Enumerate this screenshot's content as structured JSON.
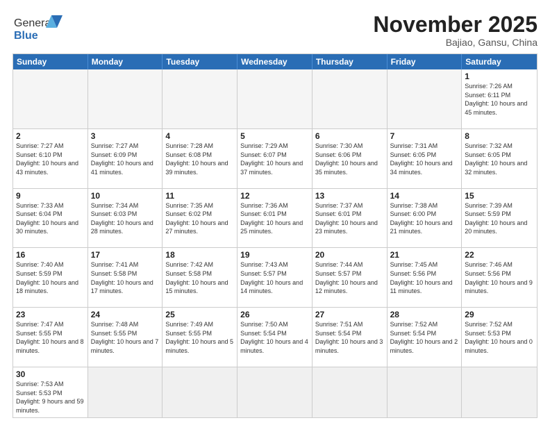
{
  "header": {
    "logo_general": "General",
    "logo_blue": "Blue",
    "title": "November 2025",
    "subtitle": "Bajiao, Gansu, China"
  },
  "days_of_week": [
    "Sunday",
    "Monday",
    "Tuesday",
    "Wednesday",
    "Thursday",
    "Friday",
    "Saturday"
  ],
  "weeks": [
    [
      {
        "day": "",
        "info": ""
      },
      {
        "day": "",
        "info": ""
      },
      {
        "day": "",
        "info": ""
      },
      {
        "day": "",
        "info": ""
      },
      {
        "day": "",
        "info": ""
      },
      {
        "day": "",
        "info": ""
      },
      {
        "day": "1",
        "info": "Sunrise: 7:26 AM\nSunset: 6:11 PM\nDaylight: 10 hours and 45 minutes."
      }
    ],
    [
      {
        "day": "2",
        "info": "Sunrise: 7:27 AM\nSunset: 6:10 PM\nDaylight: 10 hours and 43 minutes."
      },
      {
        "day": "3",
        "info": "Sunrise: 7:27 AM\nSunset: 6:09 PM\nDaylight: 10 hours and 41 minutes."
      },
      {
        "day": "4",
        "info": "Sunrise: 7:28 AM\nSunset: 6:08 PM\nDaylight: 10 hours and 39 minutes."
      },
      {
        "day": "5",
        "info": "Sunrise: 7:29 AM\nSunset: 6:07 PM\nDaylight: 10 hours and 37 minutes."
      },
      {
        "day": "6",
        "info": "Sunrise: 7:30 AM\nSunset: 6:06 PM\nDaylight: 10 hours and 35 minutes."
      },
      {
        "day": "7",
        "info": "Sunrise: 7:31 AM\nSunset: 6:05 PM\nDaylight: 10 hours and 34 minutes."
      },
      {
        "day": "8",
        "info": "Sunrise: 7:32 AM\nSunset: 6:05 PM\nDaylight: 10 hours and 32 minutes."
      }
    ],
    [
      {
        "day": "9",
        "info": "Sunrise: 7:33 AM\nSunset: 6:04 PM\nDaylight: 10 hours and 30 minutes."
      },
      {
        "day": "10",
        "info": "Sunrise: 7:34 AM\nSunset: 6:03 PM\nDaylight: 10 hours and 28 minutes."
      },
      {
        "day": "11",
        "info": "Sunrise: 7:35 AM\nSunset: 6:02 PM\nDaylight: 10 hours and 27 minutes."
      },
      {
        "day": "12",
        "info": "Sunrise: 7:36 AM\nSunset: 6:01 PM\nDaylight: 10 hours and 25 minutes."
      },
      {
        "day": "13",
        "info": "Sunrise: 7:37 AM\nSunset: 6:01 PM\nDaylight: 10 hours and 23 minutes."
      },
      {
        "day": "14",
        "info": "Sunrise: 7:38 AM\nSunset: 6:00 PM\nDaylight: 10 hours and 21 minutes."
      },
      {
        "day": "15",
        "info": "Sunrise: 7:39 AM\nSunset: 5:59 PM\nDaylight: 10 hours and 20 minutes."
      }
    ],
    [
      {
        "day": "16",
        "info": "Sunrise: 7:40 AM\nSunset: 5:59 PM\nDaylight: 10 hours and 18 minutes."
      },
      {
        "day": "17",
        "info": "Sunrise: 7:41 AM\nSunset: 5:58 PM\nDaylight: 10 hours and 17 minutes."
      },
      {
        "day": "18",
        "info": "Sunrise: 7:42 AM\nSunset: 5:58 PM\nDaylight: 10 hours and 15 minutes."
      },
      {
        "day": "19",
        "info": "Sunrise: 7:43 AM\nSunset: 5:57 PM\nDaylight: 10 hours and 14 minutes."
      },
      {
        "day": "20",
        "info": "Sunrise: 7:44 AM\nSunset: 5:57 PM\nDaylight: 10 hours and 12 minutes."
      },
      {
        "day": "21",
        "info": "Sunrise: 7:45 AM\nSunset: 5:56 PM\nDaylight: 10 hours and 11 minutes."
      },
      {
        "day": "22",
        "info": "Sunrise: 7:46 AM\nSunset: 5:56 PM\nDaylight: 10 hours and 9 minutes."
      }
    ],
    [
      {
        "day": "23",
        "info": "Sunrise: 7:47 AM\nSunset: 5:55 PM\nDaylight: 10 hours and 8 minutes."
      },
      {
        "day": "24",
        "info": "Sunrise: 7:48 AM\nSunset: 5:55 PM\nDaylight: 10 hours and 7 minutes."
      },
      {
        "day": "25",
        "info": "Sunrise: 7:49 AM\nSunset: 5:55 PM\nDaylight: 10 hours and 5 minutes."
      },
      {
        "day": "26",
        "info": "Sunrise: 7:50 AM\nSunset: 5:54 PM\nDaylight: 10 hours and 4 minutes."
      },
      {
        "day": "27",
        "info": "Sunrise: 7:51 AM\nSunset: 5:54 PM\nDaylight: 10 hours and 3 minutes."
      },
      {
        "day": "28",
        "info": "Sunrise: 7:52 AM\nSunset: 5:54 PM\nDaylight: 10 hours and 2 minutes."
      },
      {
        "day": "29",
        "info": "Sunrise: 7:52 AM\nSunset: 5:53 PM\nDaylight: 10 hours and 0 minutes."
      }
    ],
    [
      {
        "day": "30",
        "info": "Sunrise: 7:53 AM\nSunset: 5:53 PM\nDaylight: 9 hours and 59 minutes."
      },
      {
        "day": "",
        "info": ""
      },
      {
        "day": "",
        "info": ""
      },
      {
        "day": "",
        "info": ""
      },
      {
        "day": "",
        "info": ""
      },
      {
        "day": "",
        "info": ""
      },
      {
        "day": "",
        "info": ""
      }
    ]
  ]
}
